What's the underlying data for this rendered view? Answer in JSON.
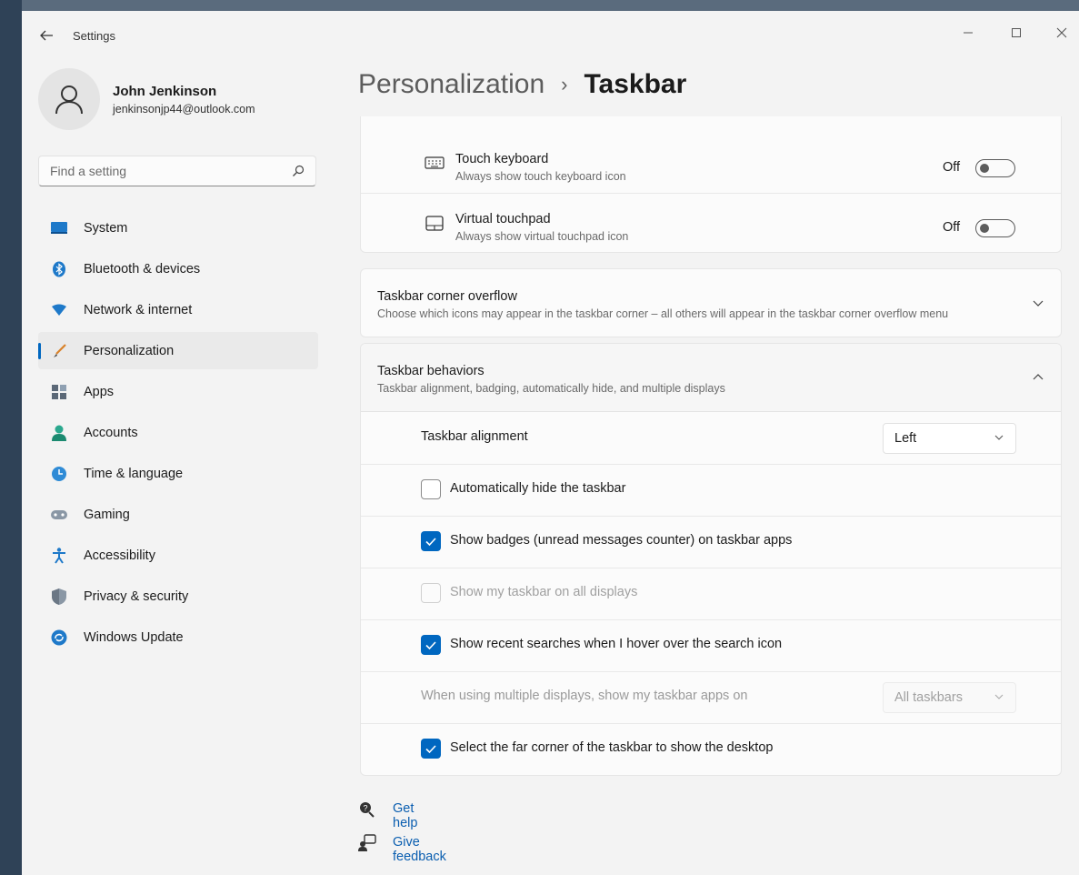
{
  "window": {
    "app_title": "Settings",
    "controls": {
      "minimize": "—",
      "maximize": "☐",
      "close": "✕"
    }
  },
  "profile": {
    "name": "John Jenkinson",
    "email": "jenkinsonjp44@outlook.com"
  },
  "search": {
    "placeholder": "Find a setting"
  },
  "sidebar": {
    "items": [
      {
        "label": "System",
        "icon": "system-icon"
      },
      {
        "label": "Bluetooth & devices",
        "icon": "bluetooth-icon"
      },
      {
        "label": "Network & internet",
        "icon": "network-icon"
      },
      {
        "label": "Personalization",
        "icon": "brush-icon",
        "active": true
      },
      {
        "label": "Apps",
        "icon": "apps-icon"
      },
      {
        "label": "Accounts",
        "icon": "accounts-icon"
      },
      {
        "label": "Time & language",
        "icon": "globe-clock-icon"
      },
      {
        "label": "Gaming",
        "icon": "gamepad-icon"
      },
      {
        "label": "Accessibility",
        "icon": "accessibility-icon"
      },
      {
        "label": "Privacy & security",
        "icon": "shield-icon"
      },
      {
        "label": "Windows Update",
        "icon": "update-icon"
      }
    ]
  },
  "breadcrumb": {
    "parent": "Personalization",
    "separator": "›",
    "current": "Taskbar"
  },
  "system_tray_icons": {
    "touch_keyboard": {
      "title": "Touch keyboard",
      "subtitle": "Always show touch keyboard icon",
      "state": "Off"
    },
    "virtual_touchpad": {
      "title": "Virtual touchpad",
      "subtitle": "Always show virtual touchpad icon",
      "state": "Off"
    }
  },
  "corner_overflow": {
    "title": "Taskbar corner overflow",
    "subtitle": "Choose which icons may appear in the taskbar corner – all others will appear in the taskbar corner overflow menu"
  },
  "behaviors": {
    "title": "Taskbar behaviors",
    "subtitle": "Taskbar alignment, badging, automatically hide, and multiple displays",
    "alignment": {
      "label": "Taskbar alignment",
      "value": "Left"
    },
    "auto_hide": {
      "label": "Automatically hide the taskbar",
      "checked": false
    },
    "badges": {
      "label": "Show badges (unread messages counter) on taskbar apps",
      "checked": true
    },
    "all_displays": {
      "label": "Show my taskbar on all displays",
      "checked": false,
      "disabled": true
    },
    "recent_searches": {
      "label": "Show recent searches when I hover over the search icon",
      "checked": true
    },
    "multi_display": {
      "label": "When using multiple displays, show my taskbar apps on",
      "value": "All taskbars",
      "disabled": true
    },
    "far_corner": {
      "label": "Select the far corner of the taskbar to show the desktop",
      "checked": true
    }
  },
  "footer_links": {
    "help": "Get help",
    "feedback": "Give feedback"
  },
  "colors": {
    "accent": "#0067c0",
    "link": "#0a5eb0"
  }
}
